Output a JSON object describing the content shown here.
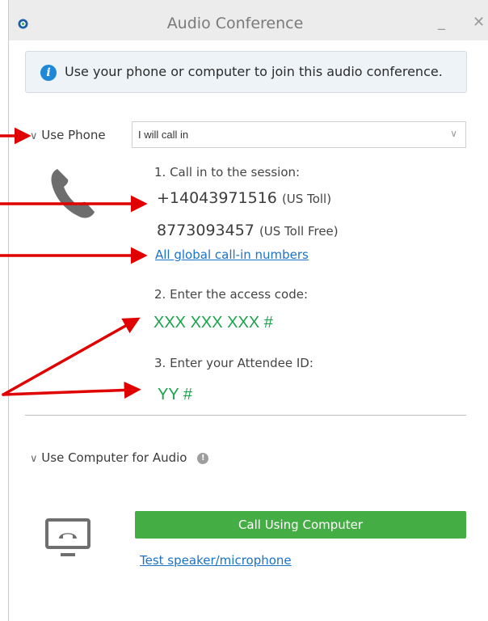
{
  "window": {
    "title": "Audio Conference",
    "minimize_glyph": "_",
    "close_glyph": "✕"
  },
  "banner": {
    "icon": "info-icon",
    "icon_glyph": "i",
    "text": "Use your phone or computer to join this audio conference."
  },
  "phone_section": {
    "toggle_label": "Use Phone",
    "chevron": "∨",
    "select_value": "I will call in",
    "select_arrow": "∨",
    "step1": "1. Call in to the session:",
    "number1": "+14043971516",
    "number1_label": "(US Toll)",
    "number2": "8773093457",
    "number2_label": "(US Toll Free)",
    "global_link": "All global call-in numbers",
    "step2": "2. Enter the access code:",
    "access_code": "XXX XXX XXX #",
    "step3": "3. Enter your Attendee ID:",
    "attendee_id": "YY #"
  },
  "computer_section": {
    "toggle_label": "Use Computer for Audio",
    "chevron": "∨",
    "help_glyph": "!",
    "call_button": "Call Using Computer",
    "test_link": "Test speaker/microphone"
  },
  "colors": {
    "annotation_arrow": "#e00000",
    "accent_green": "#44ad44",
    "code_green": "#19a34a",
    "link_blue": "#1a72c9",
    "info_blue": "#1e88d8"
  }
}
